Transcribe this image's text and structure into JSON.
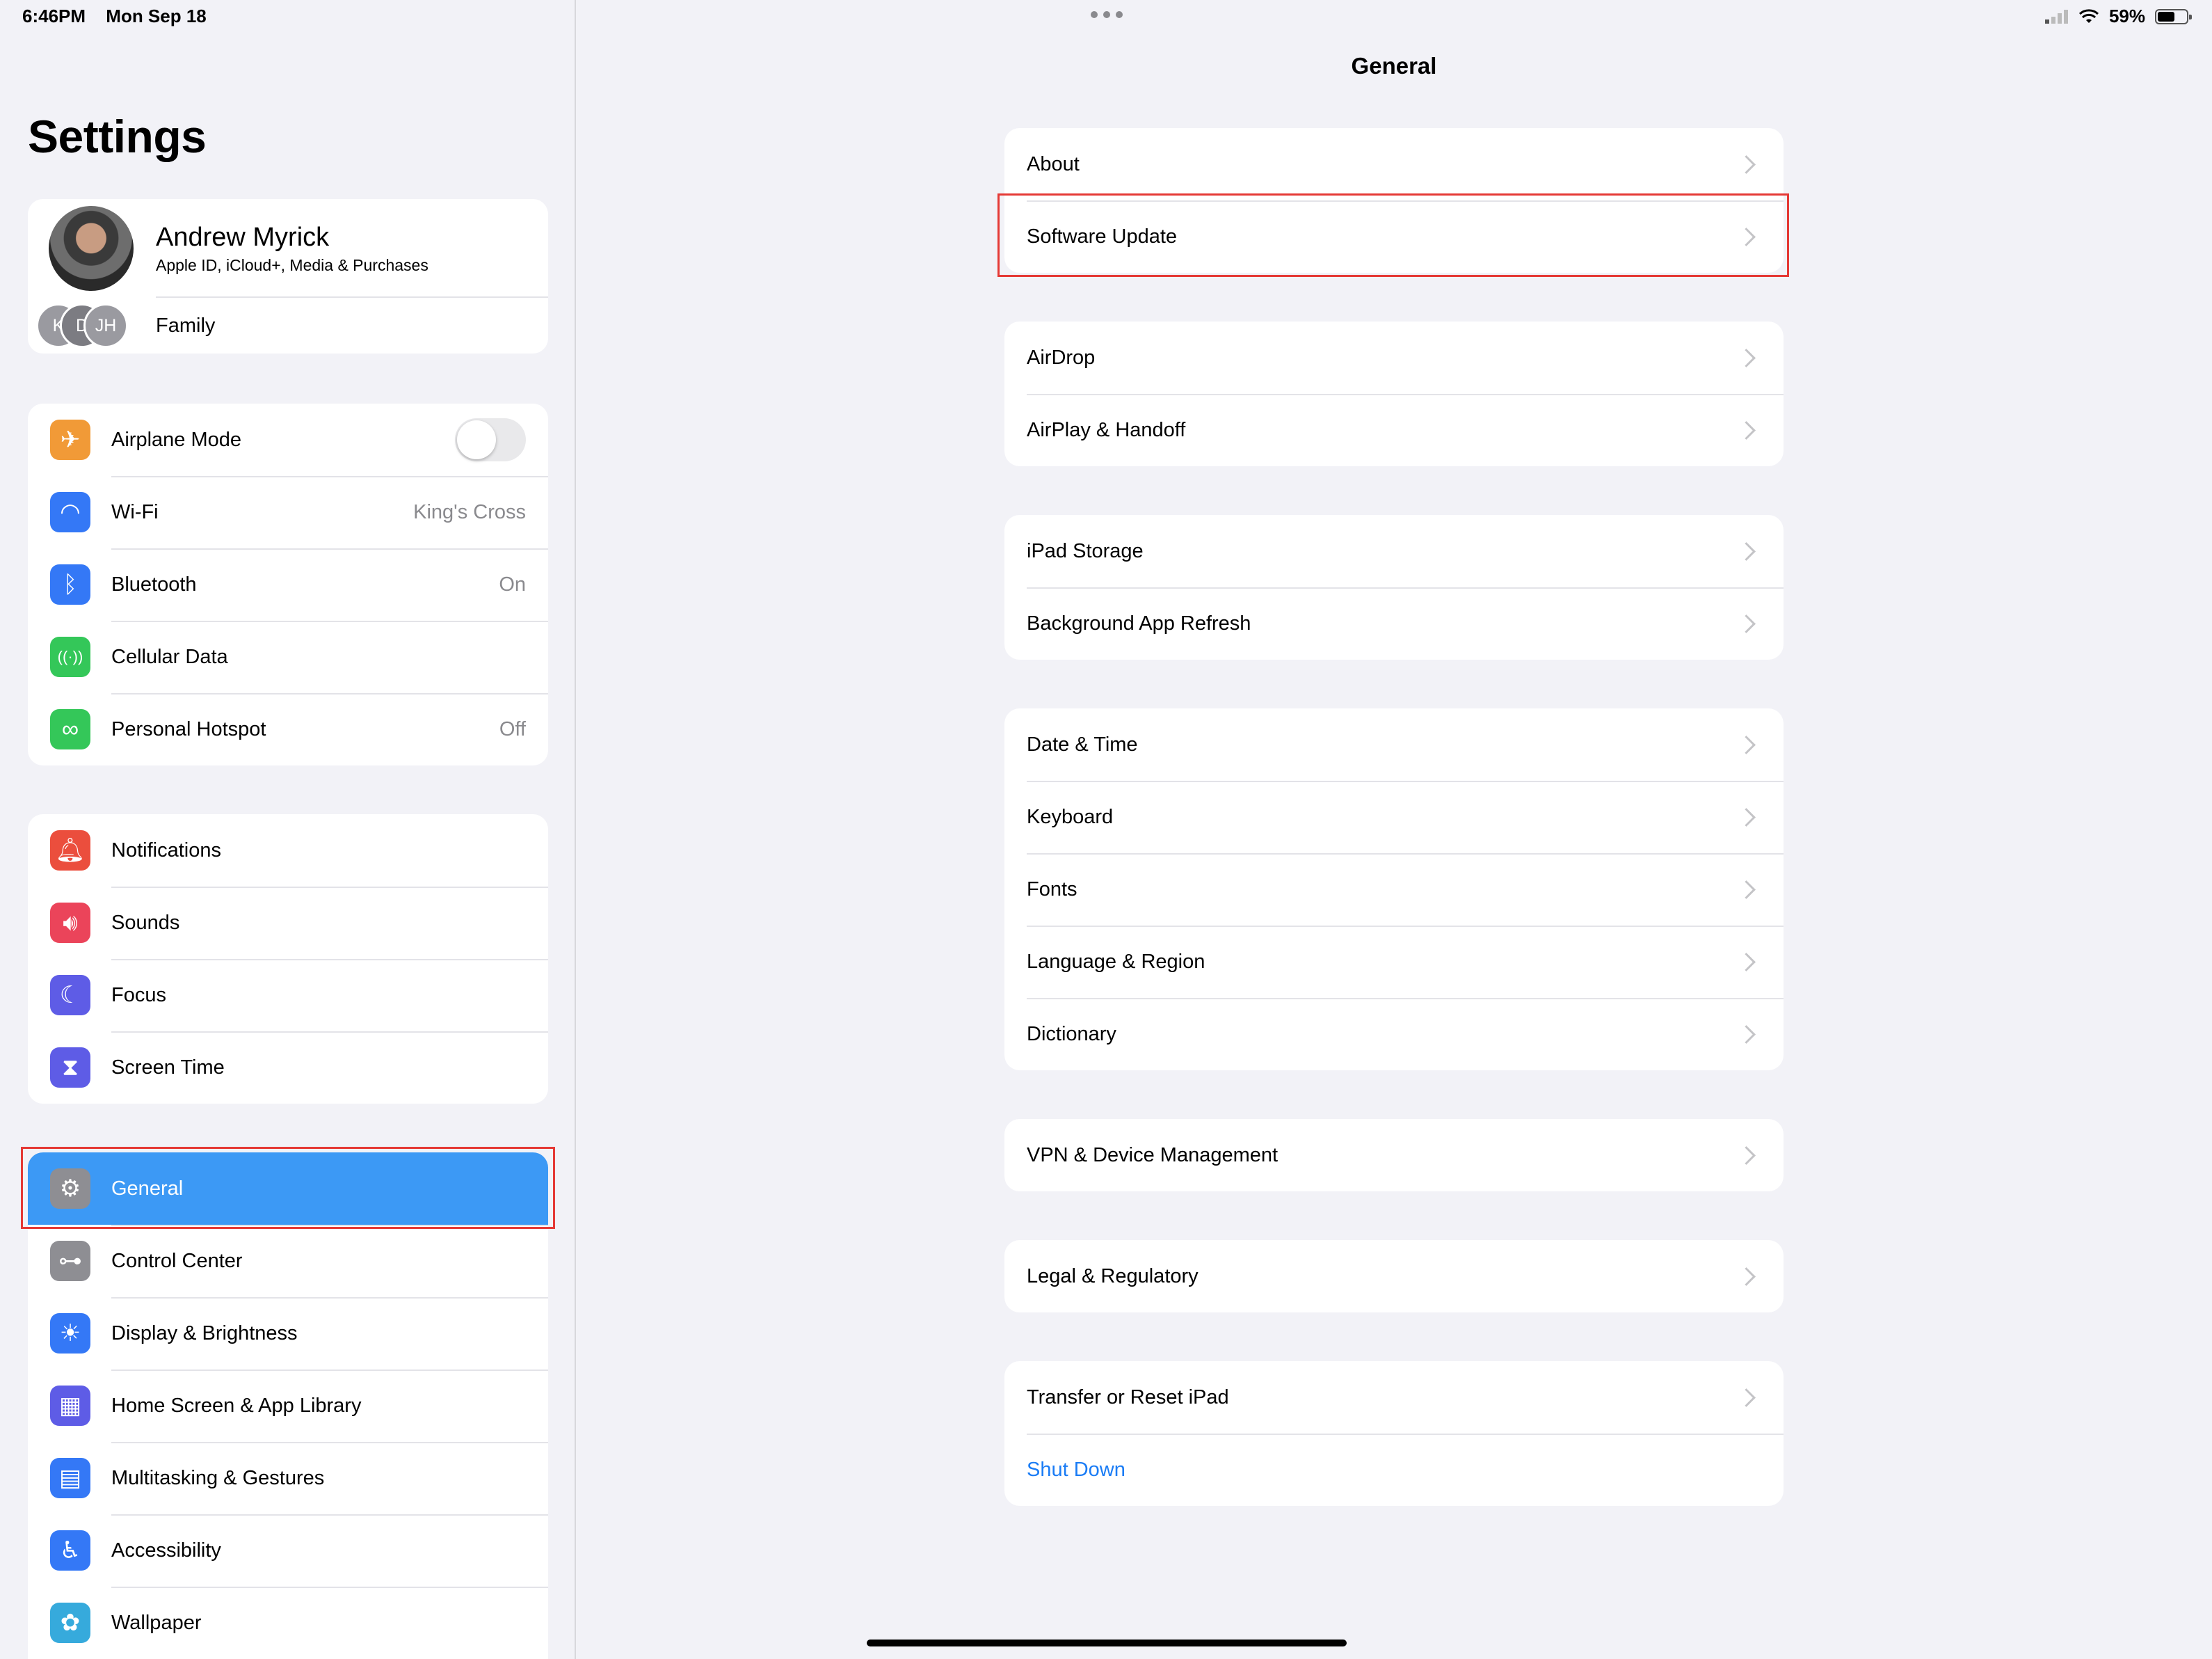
{
  "status_bar": {
    "time": "6:46PM",
    "date": "Mon Sep 18",
    "battery": "59%",
    "battery_level": 0.59
  },
  "sidebar": {
    "title": "Settings",
    "profile": {
      "name": "Andrew Myrick",
      "subtitle": "Apple ID, iCloud+, Media & Purchases",
      "family_label": "Family",
      "family_initials": [
        "K",
        "D",
        "JH"
      ]
    },
    "group1": [
      {
        "label": "Airplane Mode",
        "icon": "airplane-icon",
        "color": "#f19a37",
        "toggle": false
      },
      {
        "label": "Wi-Fi",
        "icon": "wifi-icon",
        "color": "#3478f6",
        "value": "King's Cross"
      },
      {
        "label": "Bluetooth",
        "icon": "bluetooth-icon",
        "color": "#3478f6",
        "value": "On"
      },
      {
        "label": "Cellular Data",
        "icon": "antenna-icon",
        "color": "#34c759"
      },
      {
        "label": "Personal Hotspot",
        "icon": "link-icon",
        "color": "#34c759",
        "value": "Off"
      }
    ],
    "group2": [
      {
        "label": "Notifications",
        "icon": "bell-icon",
        "color": "#eb4e3d"
      },
      {
        "label": "Sounds",
        "icon": "speaker-icon",
        "color": "#eb445a"
      },
      {
        "label": "Focus",
        "icon": "moon-icon",
        "color": "#5e5ce6"
      },
      {
        "label": "Screen Time",
        "icon": "hourglass-icon",
        "color": "#5e5ce6"
      }
    ],
    "group3": [
      {
        "label": "General",
        "icon": "gear-icon",
        "color": "#8e8e93",
        "selected": true
      },
      {
        "label": "Control Center",
        "icon": "switches-icon",
        "color": "#8e8e93"
      },
      {
        "label": "Display & Brightness",
        "icon": "sun-icon",
        "color": "#3478f6"
      },
      {
        "label": "Home Screen & App Library",
        "icon": "grid-icon",
        "color": "#5e5ce6"
      },
      {
        "label": "Multitasking & Gestures",
        "icon": "multitask-icon",
        "color": "#3478f6"
      },
      {
        "label": "Accessibility",
        "icon": "accessibility-icon",
        "color": "#3478f6"
      },
      {
        "label": "Wallpaper",
        "icon": "flower-icon",
        "color": "#36aadc"
      }
    ]
  },
  "detail": {
    "title": "General",
    "groups": [
      [
        "About",
        "Software Update"
      ],
      [
        "AirDrop",
        "AirPlay & Handoff"
      ],
      [
        "iPad Storage",
        "Background App Refresh"
      ],
      [
        "Date & Time",
        "Keyboard",
        "Fonts",
        "Language & Region",
        "Dictionary"
      ],
      [
        "VPN & Device Management"
      ],
      [
        "Legal & Regulatory"
      ],
      [
        "Transfer or Reset iPad"
      ]
    ],
    "shut_down": "Shut Down"
  },
  "colors": {
    "accent": "#1a7cf5",
    "selected": "#3c99f5",
    "highlight": "#e53935"
  }
}
